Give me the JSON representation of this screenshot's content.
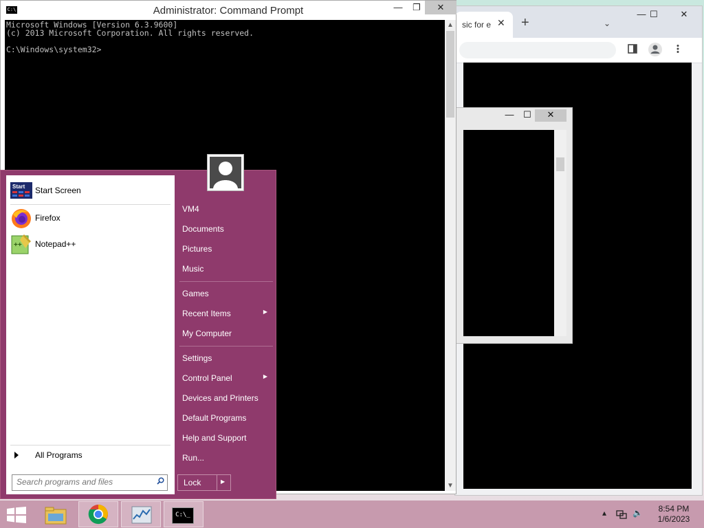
{
  "cmd": {
    "title": "Administrator:  Command Prompt",
    "app_icon": "C:\\",
    "buttons": {
      "minimize": "—",
      "maximize": "❐",
      "close": "✕"
    },
    "lines": [
      "Microsoft Windows [Version 6.3.9600]",
      "(c) 2013 Microsoft Corporation. All rights reserved.",
      "",
      "C:\\Windows\\system32>"
    ]
  },
  "chrome": {
    "tab_title": "sic for e",
    "tab_close": "✕",
    "new_tab": "+",
    "tab_search": "⌄",
    "buttons": {
      "minimize": "—",
      "maximize": "☐",
      "close": "✕"
    },
    "toolbar_icons": [
      "sidebar-icon",
      "profile-icon",
      "menu-icon"
    ]
  },
  "inner_window": {
    "buttons": {
      "minimize": "—",
      "maximize": "☐",
      "close": "✕"
    }
  },
  "start_menu": {
    "pinned": [
      {
        "label": "Start Screen",
        "icon": "start-screen-icon"
      },
      {
        "label": "Firefox",
        "icon": "firefox-icon"
      },
      {
        "label": "Notepad++",
        "icon": "notepad-plus-plus-icon"
      }
    ],
    "all_programs": "All Programs",
    "search_placeholder": "Search programs and files",
    "right": [
      "VM4",
      "Documents",
      "Pictures",
      "Music",
      "Games",
      "Recent Items",
      "My Computer",
      "Settings",
      "Control Panel",
      "Devices and Printers",
      "Default Programs",
      "Help and Support",
      "Run..."
    ],
    "lock_label": "Lock",
    "submenu_arrow": "▶"
  },
  "taskbar": {
    "items": [
      "windows-start-icon",
      "file-explorer-icon",
      "chrome-icon",
      "task-manager-icon",
      "command-prompt-icon"
    ],
    "cmd_icon_text": "C:\\_",
    "time": "8:54 PM",
    "date": "1/6/2023",
    "show_hidden": "▴",
    "volume": "🔈"
  },
  "colors": {
    "start_menu": "#8f3a6c",
    "taskbar": "#c79aae",
    "console_bg": "#000000",
    "console_fg": "#c0c0c0"
  }
}
